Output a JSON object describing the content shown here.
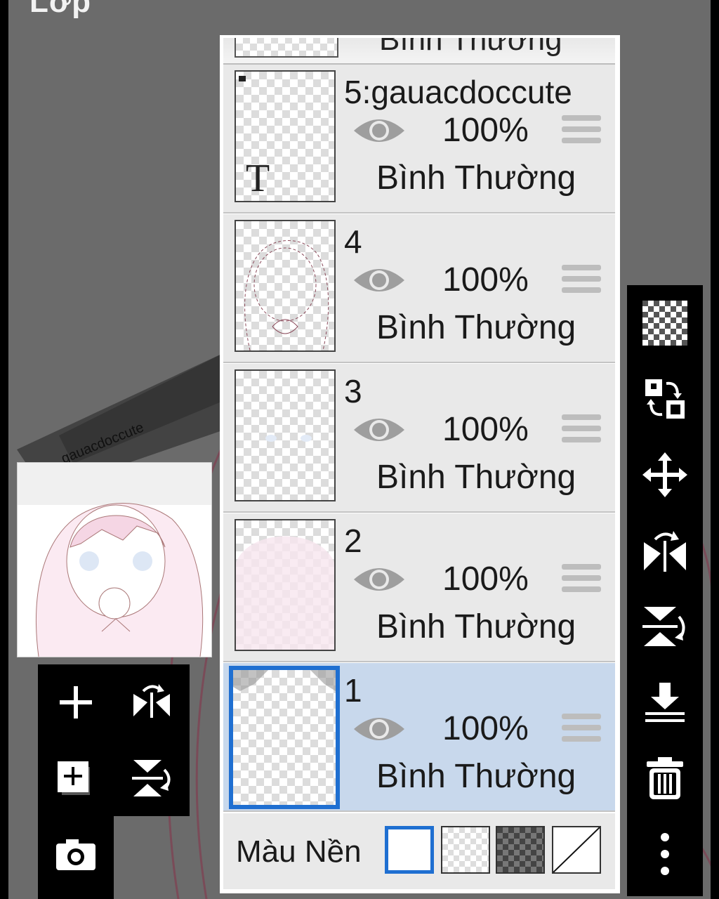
{
  "header": {
    "title": "Lớp"
  },
  "top_strip": {
    "text": "Bình Thường"
  },
  "layers": [
    {
      "name": "5:gauacdoccute",
      "opacity": "100%",
      "blend": "Bình Thường",
      "thumb_glyph": "T",
      "selected": false
    },
    {
      "name": "4",
      "opacity": "100%",
      "blend": "Bình Thường",
      "selected": false
    },
    {
      "name": "3",
      "opacity": "100%",
      "blend": "Bình Thường",
      "selected": false
    },
    {
      "name": "2",
      "opacity": "100%",
      "blend": "Bình Thường",
      "selected": false
    },
    {
      "name": "1",
      "opacity": "100%",
      "blend": "Bình Thường",
      "selected": true
    }
  ],
  "background": {
    "label": "Màu Nền",
    "options": [
      "white",
      "transparent",
      "dark-checker",
      "diagonal"
    ],
    "selected": "white"
  },
  "canvas_text": "gauacdoccute",
  "colors": {
    "selection": "#1f6fd1",
    "selected_row": "#c8d8ec",
    "row": "#e9e9e9",
    "frame": "#6b6b6b"
  },
  "left_tools": [
    "add-layer-icon",
    "flip-horizontal-icon",
    "duplicate-layer-icon",
    "flip-vertical-icon",
    "camera-icon"
  ],
  "right_tools": [
    "transparency-icon",
    "swap-layers-icon",
    "move-icon",
    "flip-horizontal-icon",
    "flip-vertical-icon",
    "merge-down-icon",
    "delete-icon",
    "more-icon"
  ]
}
